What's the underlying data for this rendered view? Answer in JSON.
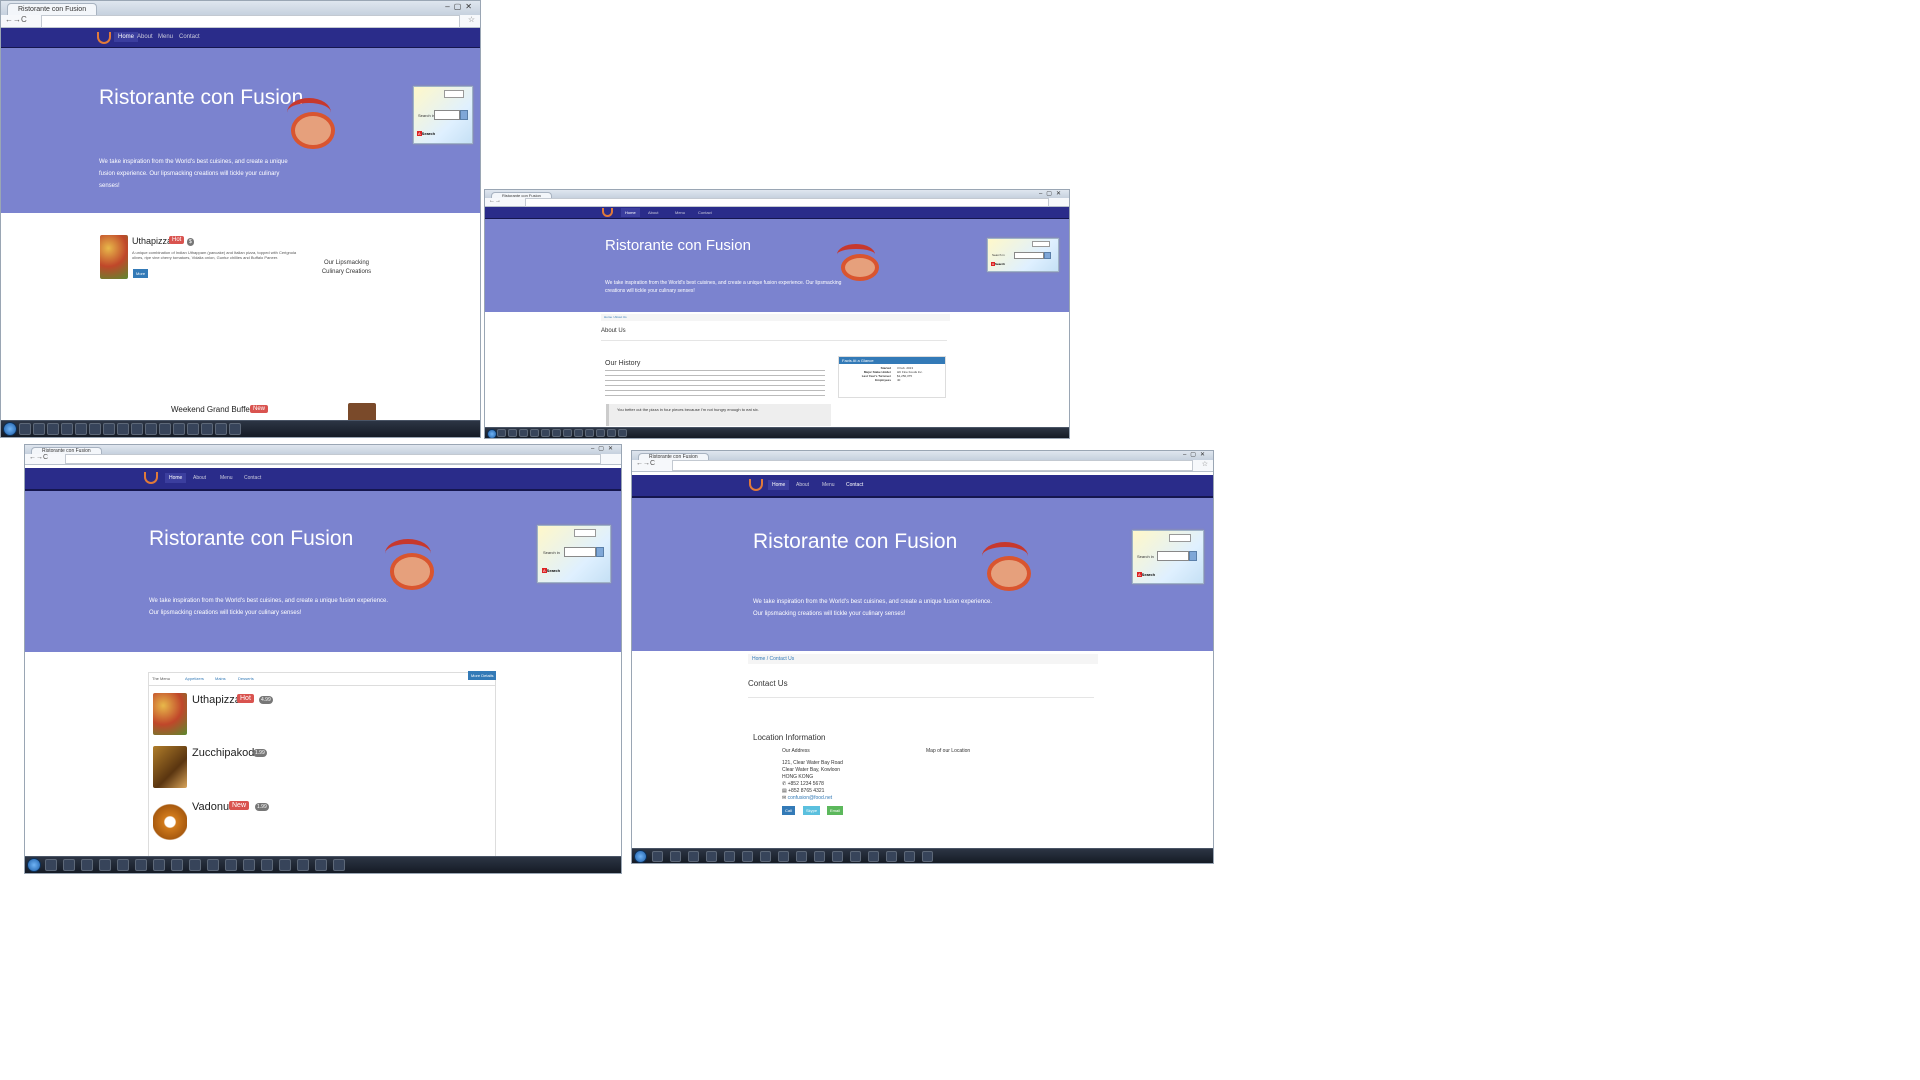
{
  "site": {
    "title": "Ristorante con Fusion",
    "tagline": "We take inspiration from the World's best cuisines, and create a unique fusion experience. Our lipsmacking creations will tickle your culinary senses!",
    "nav": {
      "home": "Home",
      "about": "About",
      "menu": "Menu",
      "contact": "Contact"
    }
  },
  "widget": {
    "search_label": "Search in",
    "brand": "Search"
  },
  "shot1": {
    "featured": {
      "name": "Uthapizza",
      "label": "Hot",
      "description": "A unique combination of Indian Uthappam (pancake) and Italian pizza, topped with Cerignola olives, ripe vine cherry tomatoes, Vidalia onion, Guntur chillies and Buffalo Paneer.",
      "button": "More",
      "side": "Our Lipsmacking Culinary Creations"
    },
    "promotion": {
      "name": "Weekend Grand Buffet",
      "label": "New"
    }
  },
  "shot2": {
    "breadcrumb": "Home / About Us",
    "heading": "About Us",
    "history_title": "Our History",
    "facts_title": "Facts At a Glance",
    "facts": [
      {
        "k": "Started",
        "v": "3 Feb. 2013"
      },
      {
        "k": "Major Stake Holder",
        "v": "HK Fine Foods Inc."
      },
      {
        "k": "Last Year's Turnover",
        "v": "$1,250,375"
      },
      {
        "k": "Employees",
        "v": "40"
      }
    ],
    "quote": "You better cut the pizza in four pieces because I'm not hungry enough to eat six."
  },
  "shot3": {
    "tabs": [
      "The Menu",
      "Appetizers",
      "Mains",
      "Desserts"
    ],
    "more_button": "More Details",
    "items": [
      {
        "name": "Uthapizza",
        "label": "Hot",
        "price": "4.99"
      },
      {
        "name": "Zucchipakoda",
        "label": "",
        "price": "1.99"
      },
      {
        "name": "Vadonut",
        "label": "New",
        "price": "1.99"
      }
    ]
  },
  "shot4": {
    "breadcrumb": "Home / Contact Us",
    "heading": "Contact Us",
    "location_title": "Location Information",
    "address_title": "Our Address",
    "map_title": "Map of our Location",
    "address_lines": [
      "121, Clear Water Bay Road",
      "Clear Water Bay, Kowloon",
      "HONG KONG"
    ],
    "phone": "+852 1234 5678",
    "fax": "+852 8765 4321",
    "email": "confusion@food.net",
    "buttons": {
      "call": "Call",
      "skype": "Skype",
      "email": "Email"
    }
  },
  "colors": {
    "navbar": "#2a2c8a",
    "jumbotron": "#7b83cf",
    "hot_label": "#d9534f",
    "taskbar": "#1c2330"
  }
}
